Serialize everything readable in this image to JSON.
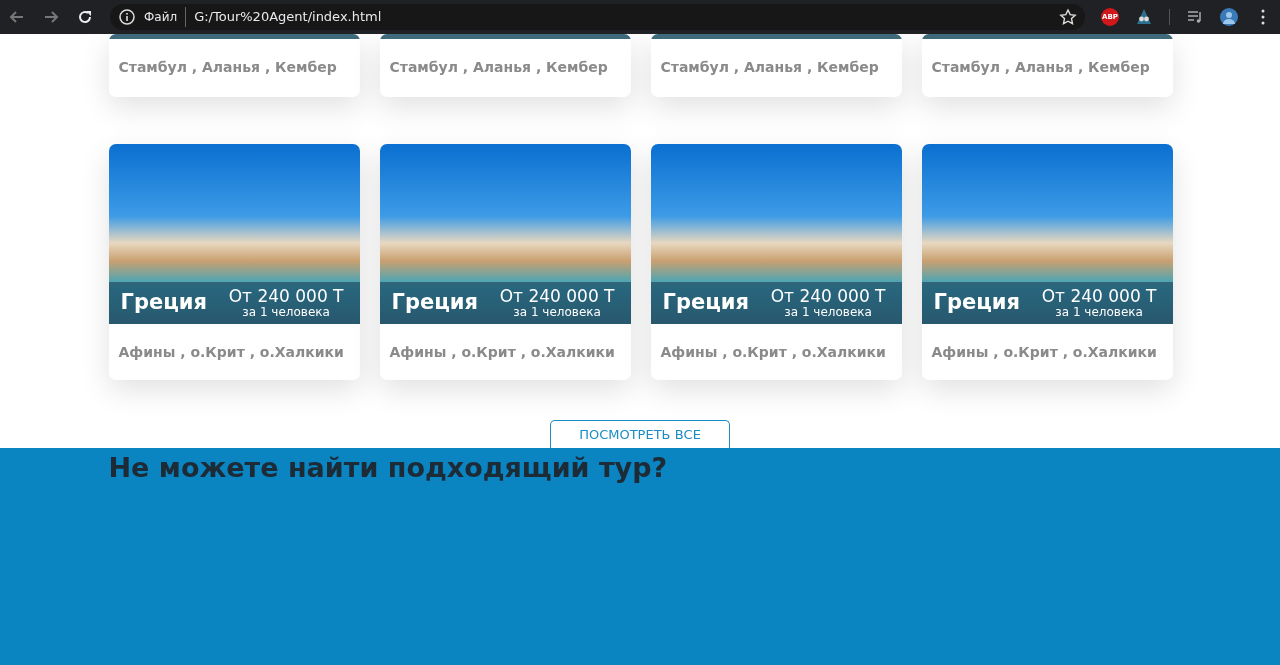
{
  "browser": {
    "scheme_label": "Файл",
    "url": "G:/Tour%20Agent/index.html",
    "extension_badge": "ABP"
  },
  "tour_rows": [
    {
      "cards": [
        {
          "cities": "Стамбул , Аланья , Кембер"
        },
        {
          "cities": "Стамбул , Аланья , Кембер"
        },
        {
          "cities": "Стамбул , Аланья , Кембер"
        },
        {
          "cities": "Стамбул , Аланья , Кембер"
        }
      ]
    },
    {
      "cards": [
        {
          "country": "Греция",
          "price": "От 240 000 Т",
          "price_note": "за 1 человека",
          "cities": "Афины , о.Крит , о.Халкики"
        },
        {
          "country": "Греция",
          "price": "От 240 000 Т",
          "price_note": "за 1 человека",
          "cities": "Афины , о.Крит , о.Халкики"
        },
        {
          "country": "Греция",
          "price": "От 240 000 Т",
          "price_note": "за 1 человека",
          "cities": "Афины , о.Крит , о.Халкики"
        },
        {
          "country": "Греция",
          "price": "От 240 000 Т",
          "price_note": "за 1 человека",
          "cities": "Афины , о.Крит , о.Халкики"
        }
      ]
    }
  ],
  "view_all_button": "ПОСМОТРЕТЬ ВСЕ",
  "cta": {
    "heading": "Не можете найти подходящий тур?"
  }
}
